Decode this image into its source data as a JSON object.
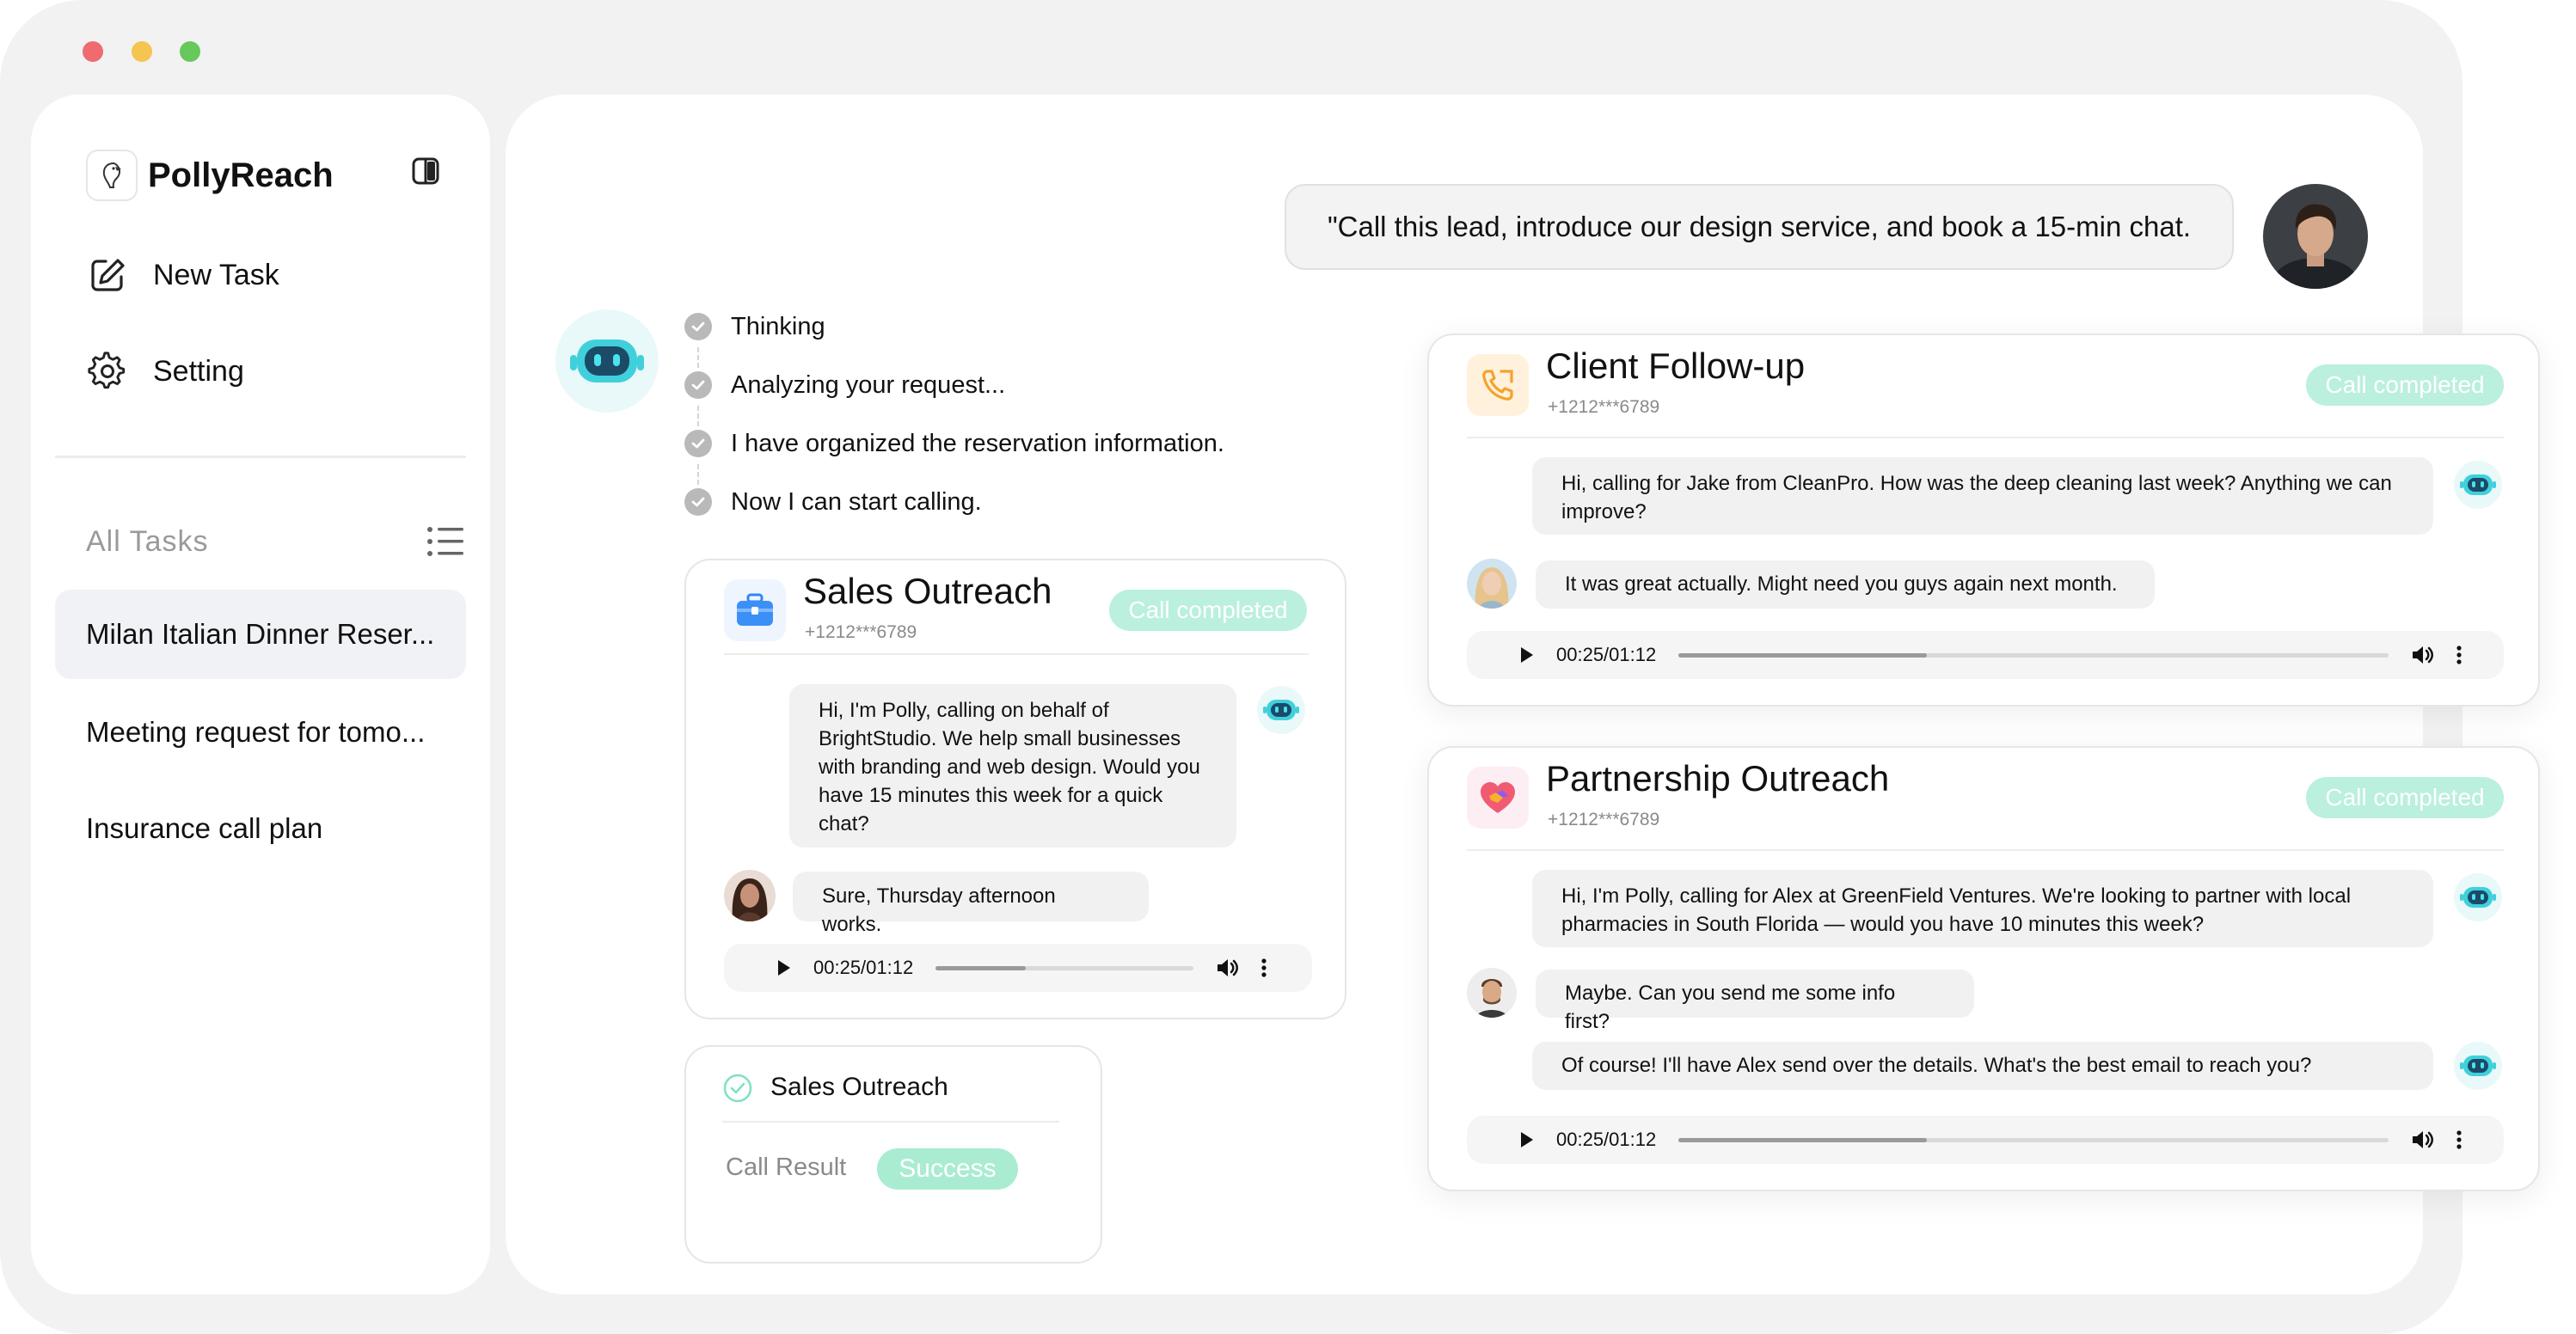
{
  "window": {
    "controls": [
      "close",
      "minimize",
      "maximize"
    ]
  },
  "sidebar": {
    "brand": "PollyReach",
    "nav": [
      {
        "label": "New Task",
        "icon": "edit-icon"
      },
      {
        "label": "Setting",
        "icon": "gear-icon"
      }
    ],
    "tasks_header": "All  Tasks",
    "tasks": [
      {
        "label": "Milan Italian Dinner Reser...",
        "active": true
      },
      {
        "label": "Meeting request for tomo...",
        "active": false
      },
      {
        "label": "Insurance call plan",
        "active": false
      }
    ]
  },
  "conversation": {
    "user_message": "\"Call this lead, introduce our design service, and book a 15-min chat.",
    "steps": [
      "Thinking",
      "Analyzing your request...",
      "I have organized the reservation information.",
      "Now I can start calling."
    ]
  },
  "sales_card": {
    "title": "Sales Outreach",
    "phone": "+1212***6789",
    "status": "Call completed",
    "messages": [
      {
        "role": "agent",
        "text": "Hi, I'm Polly, calling on behalf of BrightStudio. We help small businesses with branding and web design. Would you have 15 minutes this week for a quick chat?"
      },
      {
        "role": "contact",
        "text": "Sure, Thursday afternoon works."
      }
    ],
    "player": {
      "time": "00:25/01:12",
      "progress": 0.35
    }
  },
  "result_card": {
    "title": "Sales Outreach",
    "label": "Call Result",
    "value": "Success"
  },
  "client_card": {
    "title": "Client Follow-up",
    "phone": "+1212***6789",
    "status": "Call completed",
    "messages": [
      {
        "role": "agent",
        "text": "Hi, calling for Jake from CleanPro. How was the deep cleaning last week? Anything we can improve?"
      },
      {
        "role": "contact",
        "text": "It was great actually. Might need you guys again next month."
      }
    ],
    "player": {
      "time": "00:25/01:12",
      "progress": 0.35
    }
  },
  "partner_card": {
    "title": "Partnership Outreach",
    "phone": "+1212***6789",
    "status": "Call completed",
    "messages": [
      {
        "role": "agent",
        "text": "Hi, I'm Polly, calling for Alex at GreenField Ventures. We're looking to partner with local pharmacies in South Florida — would you have 10 minutes this week?"
      },
      {
        "role": "contact",
        "text": "Maybe. Can you send me some info first?"
      },
      {
        "role": "agent",
        "text": "Of course! I'll have Alex send over the details. What's the best email to reach you?"
      }
    ],
    "player": {
      "time": "00:25/01:12",
      "progress": 0.35
    }
  },
  "colors": {
    "accent_mint": "#baf0dd",
    "bot_cyan": "#3fd0dc",
    "window_bg": "#f2f2f3"
  }
}
